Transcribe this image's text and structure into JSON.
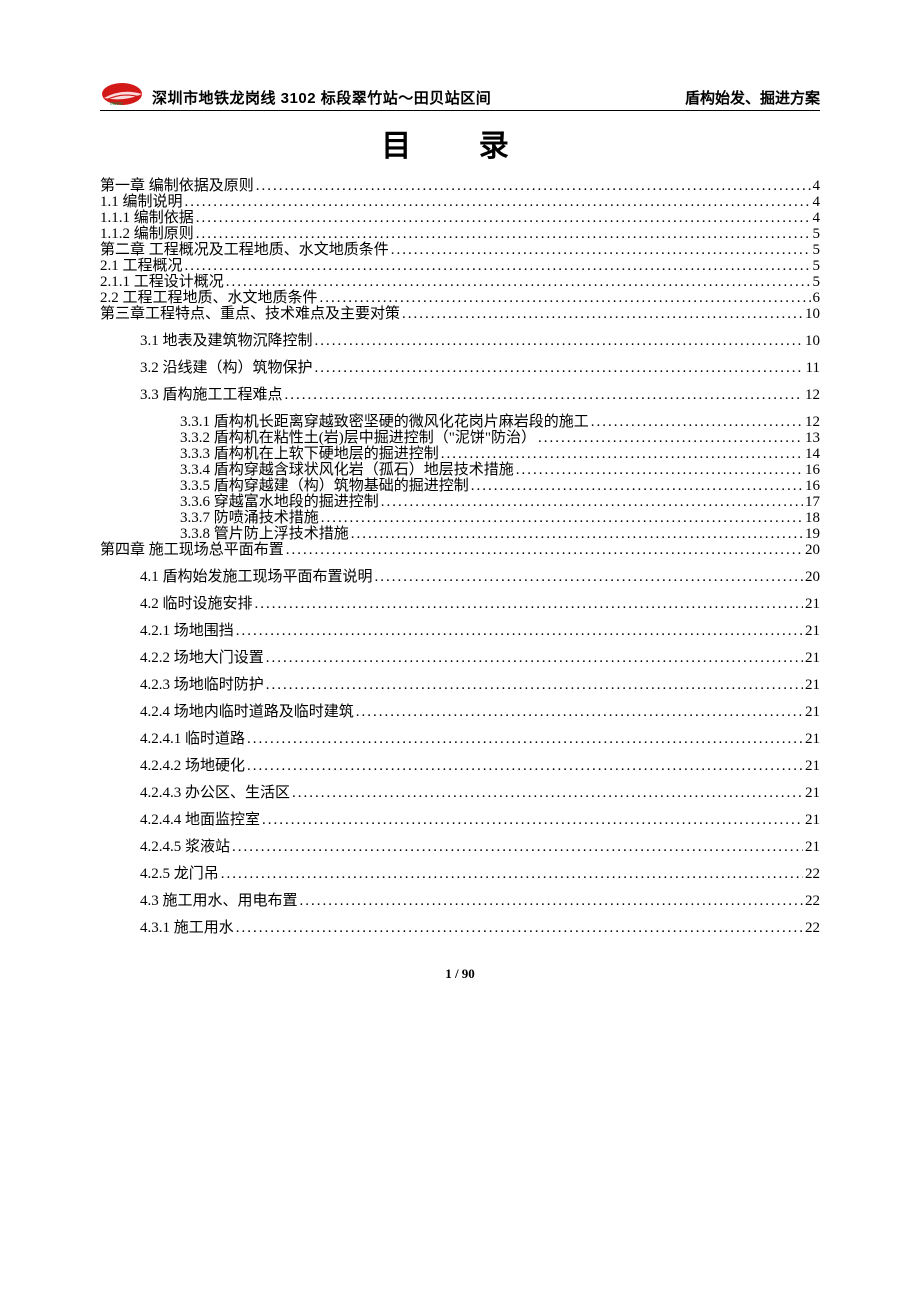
{
  "header": {
    "left": "深圳市地铁龙岗线 3102 标段翠竹站～田贝站区间",
    "right": "盾构始发、掘进方案"
  },
  "title": "目  录",
  "footer": "1 / 90",
  "toc": [
    {
      "lvl": 0,
      "label": "第一章    编制依据及原则",
      "page": "4"
    },
    {
      "lvl": 0,
      "label": "1.1 编制说明",
      "page": "4"
    },
    {
      "lvl": 0,
      "label": "1.1.1 编制依据",
      "page": "4"
    },
    {
      "lvl": 0,
      "label": "1.1.2 编制原则",
      "page": "5"
    },
    {
      "lvl": 0,
      "label": "第二章  工程概况及工程地质、水文地质条件",
      "page": "5"
    },
    {
      "lvl": 0,
      "label": "2.1 工程概况",
      "page": "5"
    },
    {
      "lvl": 0,
      "label": "2.1.1 工程设计概况",
      "page": "5"
    },
    {
      "lvl": 0,
      "label": "2.2 工程工程地质、水文地质条件",
      "page": "6"
    },
    {
      "lvl": 0,
      "label": "第三章工程特点、重点、技术难点及主要对策",
      "page": "10"
    },
    {
      "lvl": 1,
      "label": "3.1 地表及建筑物沉降控制",
      "page": "10"
    },
    {
      "lvl": 1,
      "label": "3.2 沿线建（构）筑物保护",
      "page": "11"
    },
    {
      "lvl": 1,
      "label": "3.3 盾构施工工程难点",
      "page": "12"
    },
    {
      "lvl": 2,
      "label": "3.3.1 盾构机长距离穿越致密坚硬的微风化花岗片麻岩段的施工",
      "page": "12"
    },
    {
      "lvl": 2,
      "label": "3.3.2 盾构机在粘性土(岩)层中掘进控制（\"泥饼\"防治）",
      "page": "13"
    },
    {
      "lvl": 2,
      "label": "3.3.3 盾构机在上软下硬地层的掘进控制",
      "page": "14"
    },
    {
      "lvl": 2,
      "label": "3.3.4 盾构穿越含球状风化岩（孤石）地层技术措施",
      "page": "16"
    },
    {
      "lvl": 2,
      "label": "3.3.5 盾构穿越建（构）筑物基础的掘进控制",
      "page": "16"
    },
    {
      "lvl": 2,
      "label": "3.3.6 穿越富水地段的掘进控制",
      "page": "17"
    },
    {
      "lvl": 2,
      "label": "3.3.7 防喷涌技术措施",
      "page": "18"
    },
    {
      "lvl": 2,
      "label": "3.3.8 管片防上浮技术措施",
      "page": "19"
    },
    {
      "lvl": 0,
      "label": "第四章 施工现场总平面布置",
      "page": "20"
    },
    {
      "lvl": 1,
      "label": "4.1 盾构始发施工现场平面布置说明",
      "page": "20"
    },
    {
      "lvl": 1,
      "label": "4.2 临时设施安排",
      "page": "21"
    },
    {
      "lvl": 1,
      "label": "4.2.1 场地围挡",
      "page": "21"
    },
    {
      "lvl": 1,
      "label": "4.2.2 场地大门设置",
      "page": "21"
    },
    {
      "lvl": 1,
      "label": "4.2.3 场地临时防护",
      "page": "21"
    },
    {
      "lvl": 1,
      "label": "4.2.4 场地内临时道路及临时建筑",
      "page": "21"
    },
    {
      "lvl": 1,
      "label": "4.2.4.1 临时道路",
      "page": "21"
    },
    {
      "lvl": 1,
      "label": "4.2.4.2 场地硬化",
      "page": "21"
    },
    {
      "lvl": 1,
      "label": "4.2.4.3 办公区、生活区",
      "page": "21"
    },
    {
      "lvl": 1,
      "label": "4.2.4.4 地面监控室",
      "page": "21"
    },
    {
      "lvl": 1,
      "label": "4.2.4.5 浆液站",
      "page": "21"
    },
    {
      "lvl": 1,
      "label": "4.2.5 龙门吊",
      "page": "22"
    },
    {
      "lvl": 1,
      "label": "4.3 施工用水、用电布置",
      "page": "22"
    },
    {
      "lvl": 1,
      "label": "4.3.1 施工用水",
      "page": "22"
    }
  ]
}
